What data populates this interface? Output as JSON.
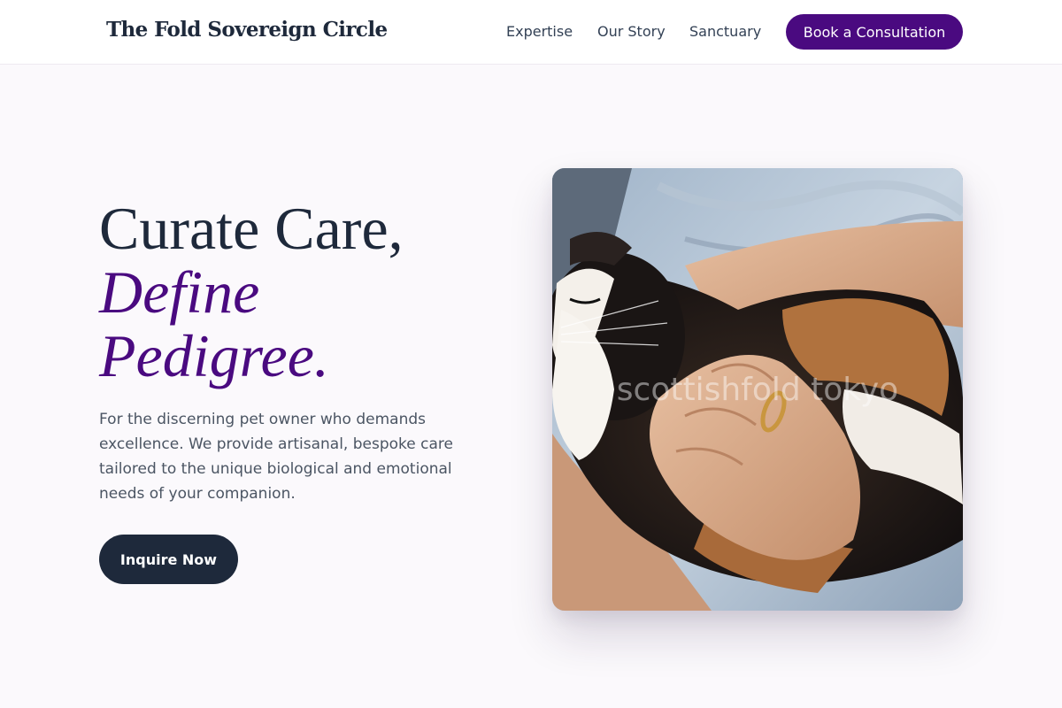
{
  "header": {
    "brand": "The Fold Sovereign Circle",
    "nav": {
      "expertise": "Expertise",
      "story": "Our Story",
      "sanctuary": "Sanctuary"
    },
    "cta_label": "Book a Consultation"
  },
  "hero": {
    "title_line1": "Curate Care,",
    "title_line2": "Define",
    "title_line3": "Pedigree.",
    "description": "For the discerning pet owner who demands excellence. We provide artisanal, bespoke care tailored to the unique biological and emotional needs of your companion.",
    "button_label": "Inquire Now",
    "image": {
      "subject": "calico Scottish Fold cat held in a person's hands",
      "watermark": "scottishfold tokyo"
    }
  },
  "colors": {
    "accent": "#4a0a80",
    "dark": "#1e293b",
    "page_background": "#fbf9fc",
    "body_text": "#4b5563"
  }
}
